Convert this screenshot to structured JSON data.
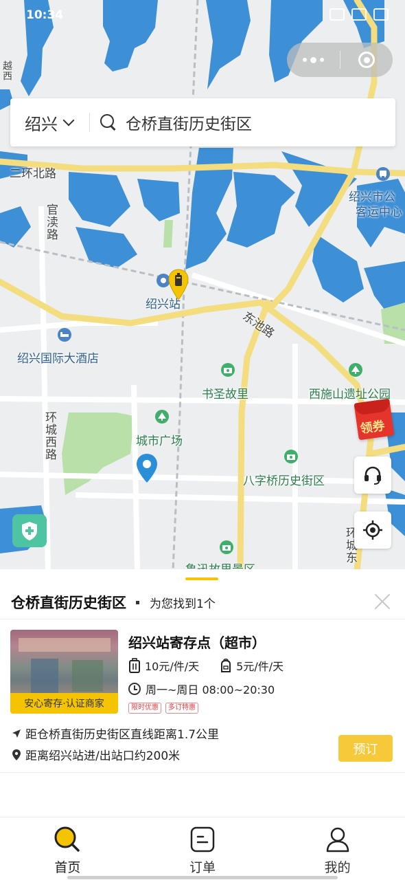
{
  "status_bar": {
    "time": "10:34"
  },
  "search": {
    "city": "绍兴",
    "query": "仓桥直街历史街区"
  },
  "map": {
    "roads": {
      "er_huan_bei_lu": "二环北路",
      "guan_du_lu": "官渎路",
      "dong_chi_lu": "东池路",
      "huan_cheng_xi_lu": "环城西路",
      "huan_cheng_dong": "环城东"
    },
    "places": {
      "xi_shan": "越西",
      "station": "绍兴站",
      "bus_center_line1": "绍兴市公",
      "bus_center_line2": "客运中心",
      "hotel": "绍兴国际大酒店",
      "shu_sheng": "书圣故里",
      "xi_shi_shan": "西施山遗址公园",
      "city_square": "城市广场",
      "ba_zi_qiao": "八字桥历史街区",
      "lu_xun": "鲁迅故里景区"
    }
  },
  "coupon": {
    "label": "领券"
  },
  "sheet": {
    "title": "仓桥直街历史街区",
    "result_count": "为您找到1个"
  },
  "store": {
    "name": "绍兴站寄存点（超市）",
    "badge": "安心寄存·认证商家",
    "price_large": "10元/件/天",
    "price_small": "5元/件/天",
    "hours": "周一~周日 08:00~20:30",
    "tags": [
      "限时优惠",
      "多订特惠"
    ],
    "distance": "距仓桥直街历史街区直线距离1.7公里",
    "exit_distance": "距离绍兴站进/出站口约200米",
    "book_label": "预订"
  },
  "tabs": [
    {
      "label": "首页",
      "icon": "home-search-icon"
    },
    {
      "label": "订单",
      "icon": "order-icon"
    },
    {
      "label": "我的",
      "icon": "profile-icon"
    }
  ],
  "colors": {
    "accent": "#f5c400",
    "water": "#3d8fd6",
    "park": "#b6dfa2",
    "road": "#f5e07a"
  }
}
